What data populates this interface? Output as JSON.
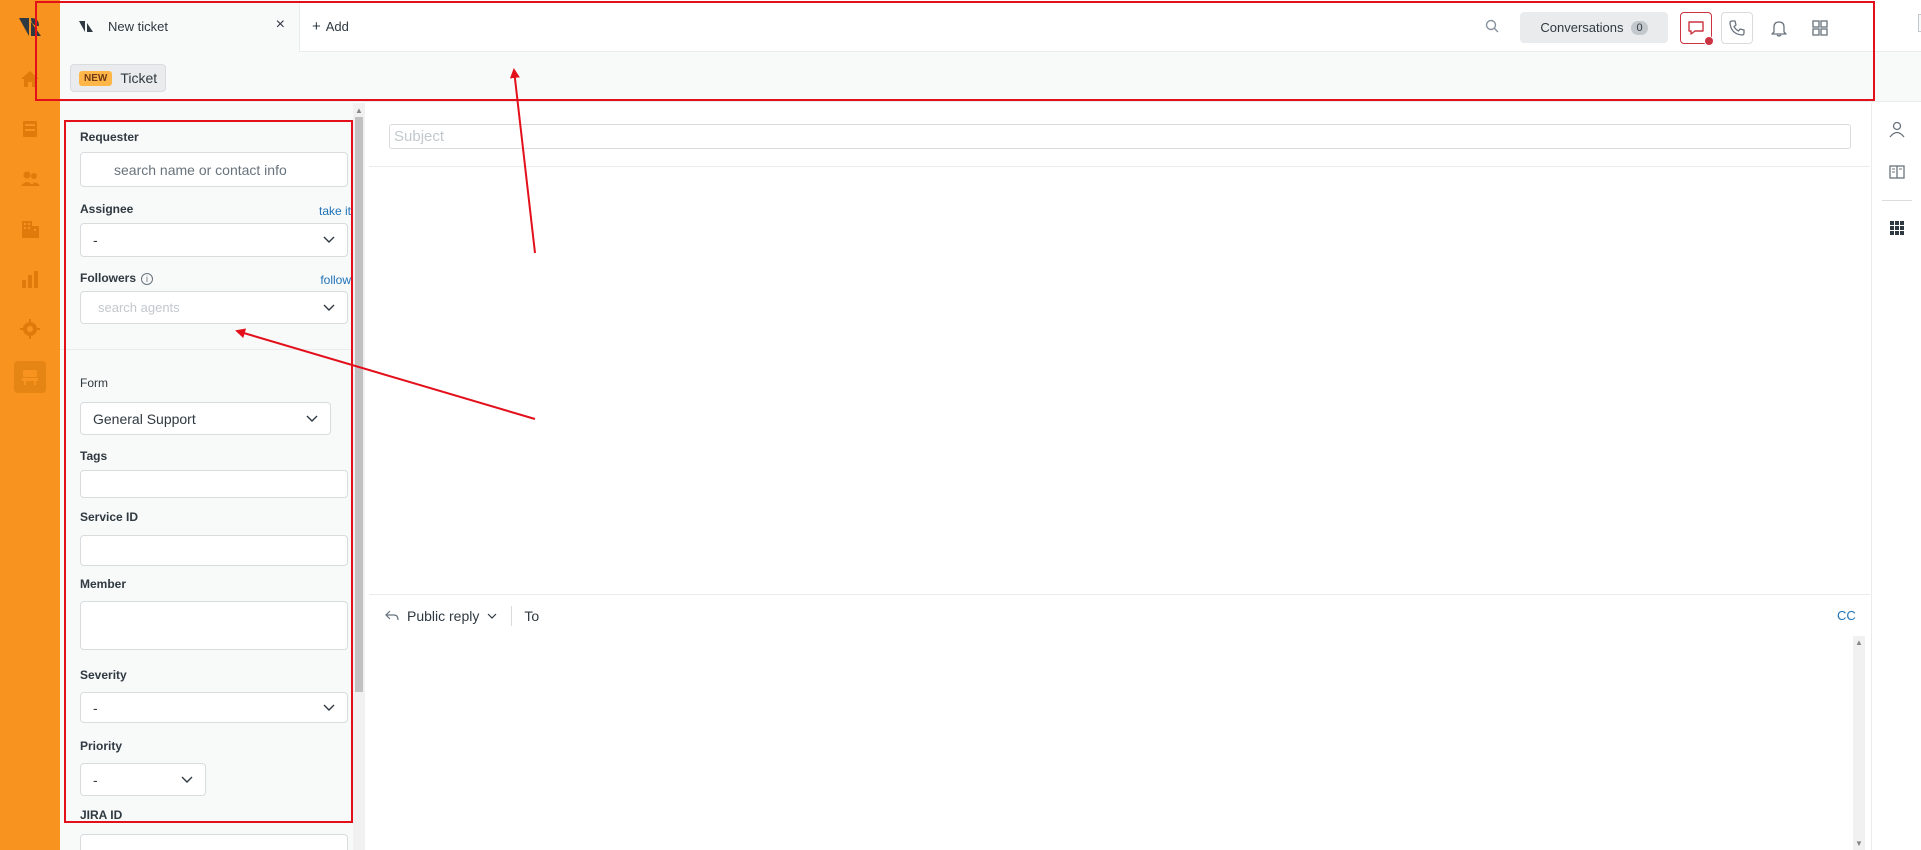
{
  "nav": {
    "items": [
      {
        "name": "home"
      },
      {
        "name": "views"
      },
      {
        "name": "customers"
      },
      {
        "name": "organizations"
      },
      {
        "name": "reporting"
      },
      {
        "name": "admin"
      },
      {
        "name": "workspace"
      }
    ]
  },
  "topbar": {
    "tab_label": "New ticket",
    "tab_close": "×",
    "add_plus": "+",
    "add_label": "Add",
    "conversations_label": "Conversations",
    "conversations_count": "0"
  },
  "ticket_header": {
    "badge": "NEW",
    "label": "Ticket"
  },
  "form": {
    "requester_label": "Requester",
    "requester_placeholder": "search name or contact info",
    "assignee_label": "Assignee",
    "assignee_link": "take it",
    "assignee_value": "-",
    "followers_label": "Followers",
    "followers_info": "i",
    "followers_link": "follow",
    "followers_placeholder": "search agents",
    "form_label": "Form",
    "form_value": "General Support",
    "tags_label": "Tags",
    "service_id_label": "Service ID",
    "member_label": "Member",
    "severity_label": "Severity",
    "severity_value": "-",
    "priority_label": "Priority",
    "priority_value": "-",
    "jira_label": "JIRA ID"
  },
  "main": {
    "subject_placeholder": "Subject",
    "reply_mode": "Public reply",
    "to_label": "To",
    "cc_label": "CC"
  },
  "colors": {
    "nav_bg": "#f7931e",
    "link": "#1f73b7",
    "annotation": "#e3101c",
    "new_badge": "#ffb648"
  }
}
